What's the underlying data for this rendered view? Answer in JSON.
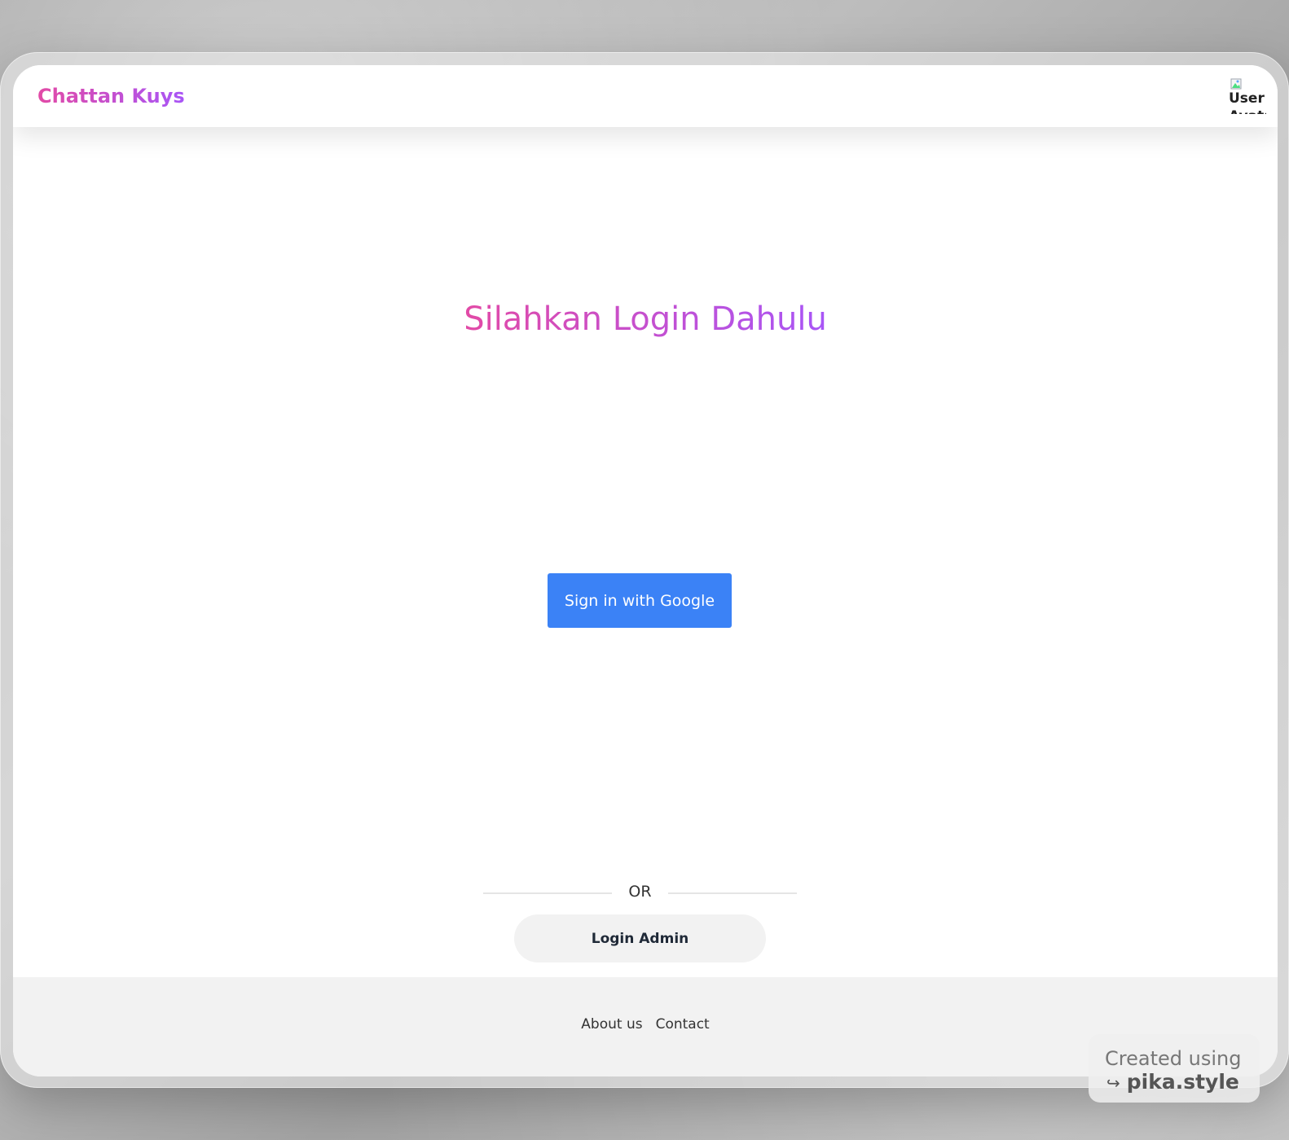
{
  "navbar": {
    "brand": "Chattan Kuys",
    "avatar_alt": "User Avatar"
  },
  "main": {
    "title": "Silahkan Login Dahulu",
    "google_button": "Sign in with Google",
    "divider_text": "OR",
    "admin_button": "Login Admin"
  },
  "footer": {
    "links": [
      "About us",
      "Contact"
    ]
  },
  "watermark": {
    "line1": "Created using",
    "arrow": "↪",
    "line2": "pika.style"
  },
  "colors": {
    "brand_gradient_start": "#e24aa6",
    "brand_gradient_end": "#a855f7",
    "google_button": "#3b82f6",
    "admin_button_bg": "#f2f2f2",
    "footer_bg": "#f2f2f2"
  }
}
